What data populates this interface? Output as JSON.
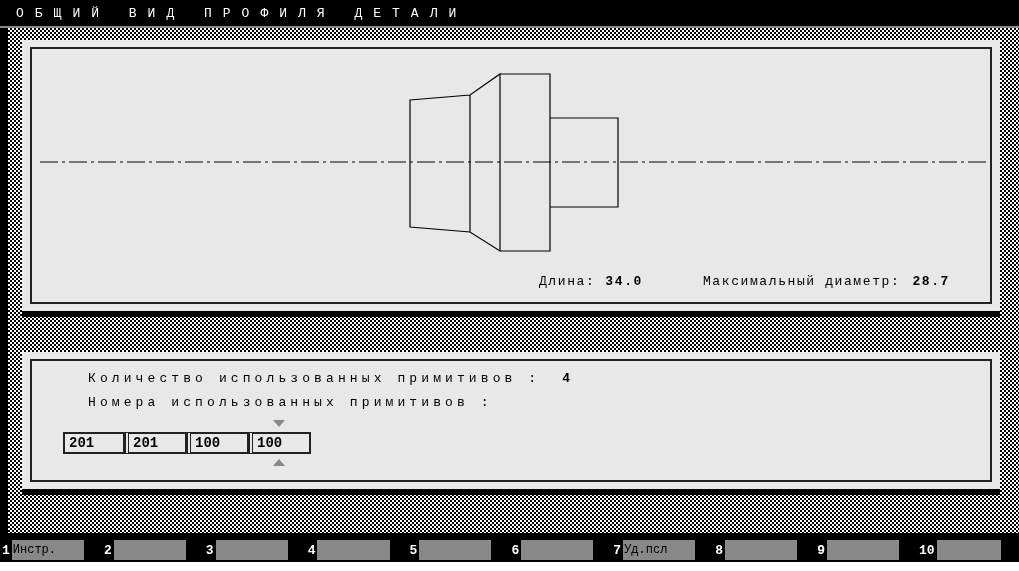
{
  "window": {
    "title": "ОБЩИЙ ВИД ПРОФИЛЯ ДЕТАЛИ"
  },
  "profile": {
    "length_label": "Длина:",
    "length": "34.0",
    "diameter_label": "Максимальный диаметр:",
    "diameter": "28.7"
  },
  "primitives": {
    "count_label": "Количество использованных примитивов :",
    "count": "4",
    "numbers_label": "Номера использованных примитивов :",
    "items": [
      {
        "value": "201",
        "selected": false
      },
      {
        "value": "201",
        "selected": false
      },
      {
        "value": "100",
        "selected": false
      },
      {
        "value": "100",
        "selected": true
      }
    ]
  },
  "function_keys": [
    {
      "number": "1",
      "label": "Инстр."
    },
    {
      "number": "2"
    },
    {
      "number": "3"
    },
    {
      "number": "4"
    },
    {
      "number": "5"
    },
    {
      "number": "6"
    },
    {
      "number": "7",
      "label": "Уд.псл"
    },
    {
      "number": "8"
    },
    {
      "number": "9"
    },
    {
      "number": "10"
    }
  ]
}
